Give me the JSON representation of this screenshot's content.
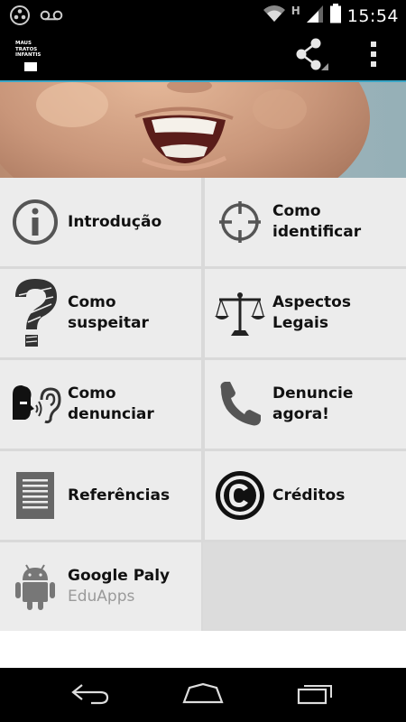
{
  "status_bar": {
    "time": "15:54",
    "network_label": "H",
    "icons": [
      "location-icon",
      "voicemail-icon",
      "wifi-icon",
      "signal-icon",
      "battery-icon"
    ]
  },
  "action_bar": {
    "logo_lines": [
      "MAUS",
      "TRATOS",
      "INFANTIS"
    ],
    "icons": [
      "share-icon",
      "overflow-menu-icon"
    ]
  },
  "tiles": [
    {
      "label": "Introdução",
      "icon": "info-icon"
    },
    {
      "label": "Como\nidentificar",
      "icon": "crosshair-icon"
    },
    {
      "label": "Como suspeitar",
      "icon": "question-mark-icon"
    },
    {
      "label": "Aspectos\nLegais",
      "icon": "scales-icon"
    },
    {
      "label": "Como\ndenunciar",
      "icon": "speaking-ear-icon"
    },
    {
      "label": "Denuncie\nagora!",
      "icon": "phone-icon"
    },
    {
      "label": "Referências",
      "icon": "document-icon"
    },
    {
      "label": "Créditos",
      "icon": "copyright-icon"
    },
    {
      "label": "Google Paly",
      "sublabel": "EduApps",
      "icon": "android-icon"
    }
  ],
  "nav_bar": {
    "icons": [
      "back-icon",
      "home-icon",
      "recent-apps-icon"
    ]
  },
  "colors": {
    "accent": "#3aa6c6",
    "tile_bg": "#ececec",
    "divider": "#d9d9d9",
    "bar_bg": "#000000"
  }
}
